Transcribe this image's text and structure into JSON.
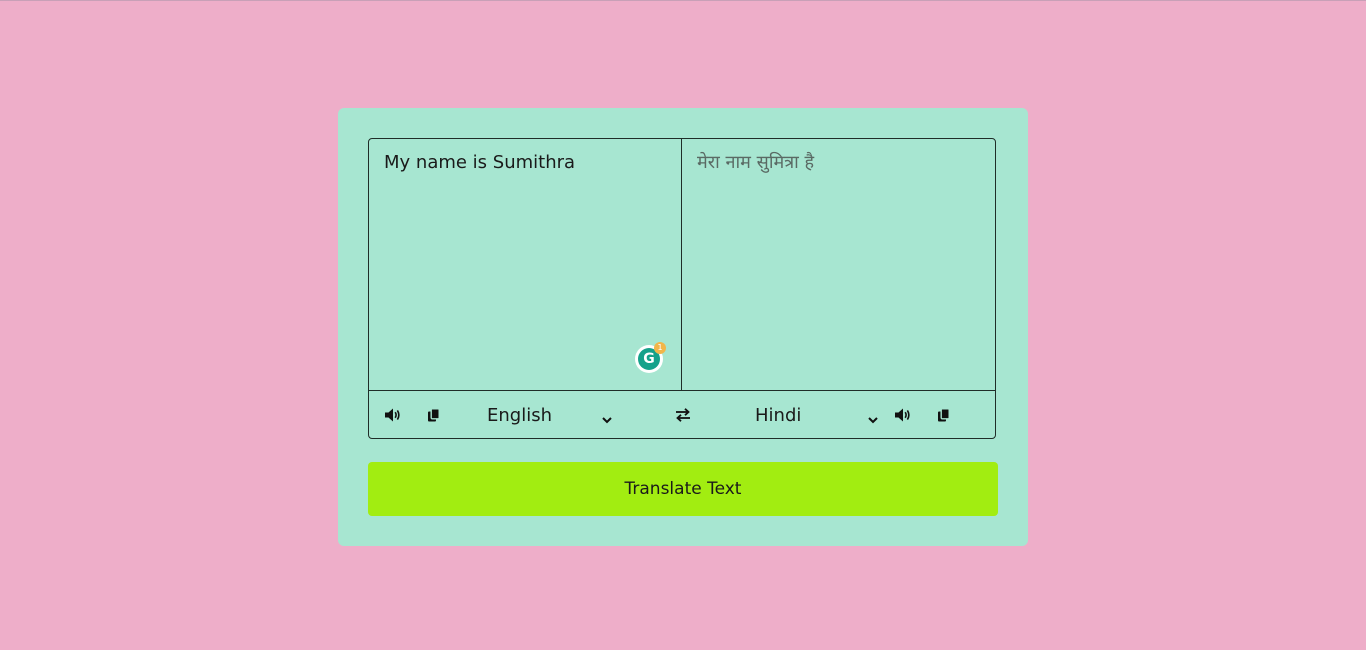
{
  "page": {
    "background_color": "#eeaec9",
    "card_color": "#a7e6d1",
    "button_color": "#a2ed11"
  },
  "translator": {
    "from_text": "My name is Sumithra",
    "to_text": "मेरा नाम सुमित्रा है",
    "from_language": "English",
    "to_language": "Hindi",
    "translate_button_label": "Translate Text"
  },
  "grammarly": {
    "badge_count": "1",
    "letter": "G"
  },
  "icons": {
    "speak": "volume-icon",
    "copy": "copy-icon",
    "swap": "exchange-icon",
    "dropdown": "chevron-down-icon"
  }
}
